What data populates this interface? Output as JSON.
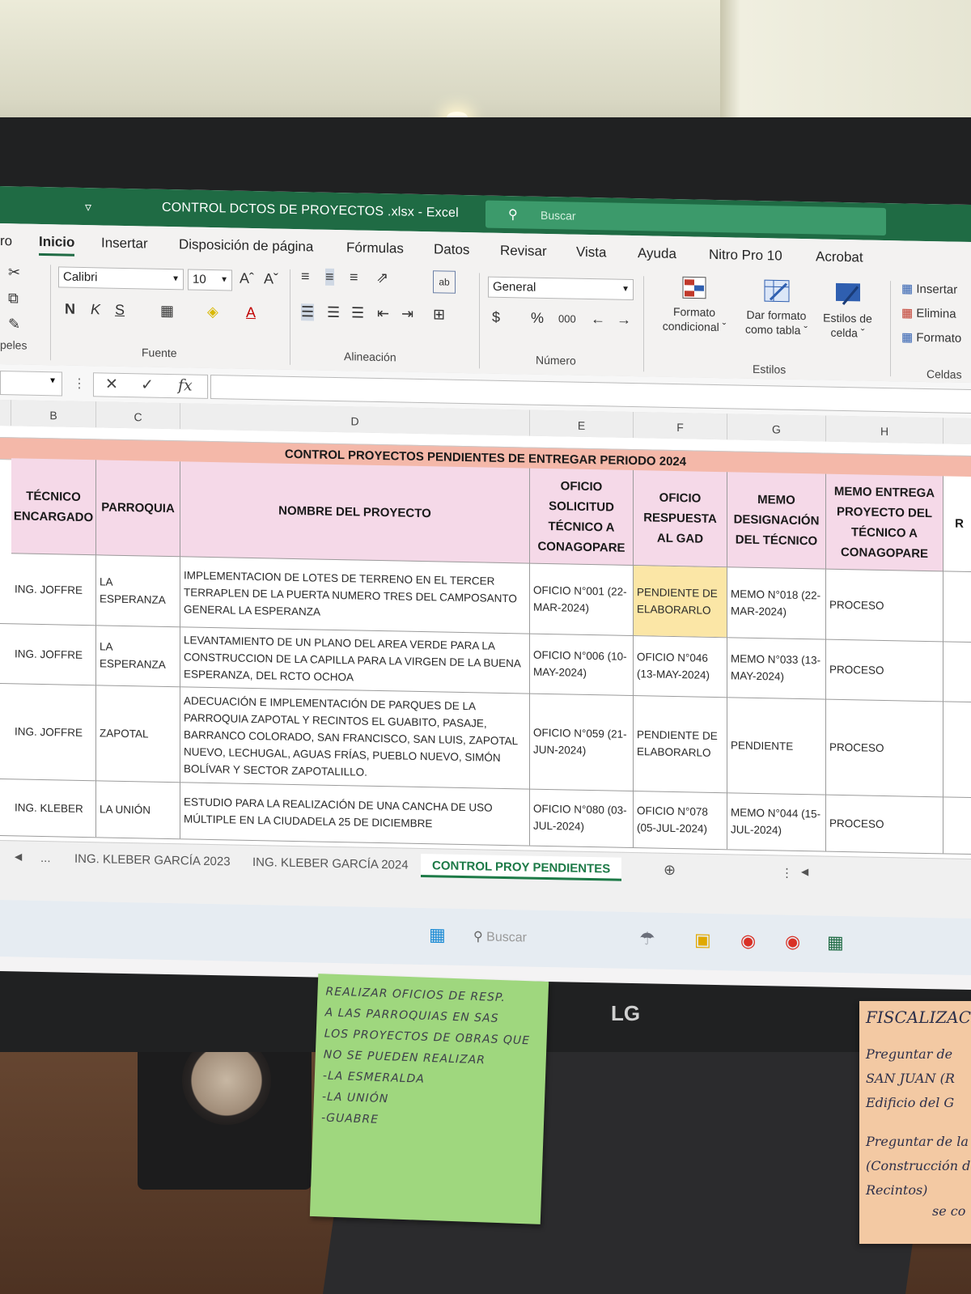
{
  "window": {
    "title": "CONTROL DCTOS DE PROYECTOS .xlsx  -  Excel",
    "search_placeholder": "Buscar",
    "qat_symbol": "▿"
  },
  "tabs": [
    "ro",
    "Inicio",
    "Insertar",
    "Disposición de página",
    "Fórmulas",
    "Datos",
    "Revisar",
    "Vista",
    "Ayuda",
    "Nitro Pro 10",
    "Acrobat"
  ],
  "ribbon": {
    "clipboard_label": "peles",
    "font_name": "Calibri",
    "font_size": "10",
    "grow_font": "Aˆ",
    "shrink_font": "Aˇ",
    "bold": "N",
    "italic": "K",
    "underline": "S",
    "font_group": "Fuente",
    "align_group": "Alineación",
    "number_format": "General",
    "currency": "$",
    "percent": "%",
    "thousands": "000",
    "number_group": "Número",
    "cond_format": [
      "Formato",
      "condicional ˇ"
    ],
    "table_format": [
      "Dar formato",
      "como tabla ˇ"
    ],
    "cell_styles": [
      "Estilos de",
      "celda ˇ"
    ],
    "styles_group": "Estilos",
    "insert": "Insertar",
    "delete": "Elimina",
    "format": "Formato",
    "cells_group": "Celdas"
  },
  "formula_bar": {
    "cancel": "✕",
    "enter": "✓",
    "fx": "fx"
  },
  "columns": [
    "B",
    "C",
    "D",
    "E",
    "F",
    "G",
    "H"
  ],
  "sheet": {
    "banner": "CONTROL PROYECTOS PENDIENTES DE ENTREGAR PERIODO 2024",
    "headers": [
      "TÉCNICO ENCARGADO",
      "PARROQUIA",
      "NOMBRE DEL PROYECTO",
      "OFICIO SOLICITUD TÉCNICO A CONAGOPARE",
      "OFICIO RESPUESTA AL GAD",
      "MEMO DESIGNACIÓN DEL TÉCNICO",
      "MEMO ENTREGA PROYECTO DEL TÉCNICO A CONAGOPARE",
      "R"
    ],
    "rows": [
      {
        "tecnico": "ING. JOFFRE",
        "parroquia": "LA ESPERANZA",
        "proyecto": "IMPLEMENTACION DE LOTES DE TERRENO EN EL TERCER TERRAPLEN DE LA PUERTA NUMERO TRES DEL CAMPOSANTO GENERAL LA ESPERANZA",
        "oficio_solicitud": "OFICIO N°001 (22-MAR-2024)",
        "oficio_respuesta": "PENDIENTE DE ELABORARLO",
        "memo_designacion": "MEMO N°018 (22-MAR-2024)",
        "memo_entrega": "PROCESO"
      },
      {
        "tecnico": "ING. JOFFRE",
        "parroquia": "LA ESPERANZA",
        "proyecto": "LEVANTAMIENTO DE UN PLANO DEL AREA VERDE PARA LA CONSTRUCCION DE LA CAPILLA PARA LA VIRGEN DE LA BUENA ESPERANZA, DEL RCTO OCHOA",
        "oficio_solicitud": "OFICIO N°006 (10-MAY-2024)",
        "oficio_respuesta": "OFICIO N°046 (13-MAY-2024)",
        "memo_designacion": "MEMO N°033 (13-MAY-2024)",
        "memo_entrega": "PROCESO"
      },
      {
        "tecnico": "ING. JOFFRE",
        "parroquia": "ZAPOTAL",
        "proyecto": "ADECUACIÓN E IMPLEMENTACIÓN DE PARQUES DE LA PARROQUIA ZAPOTAL Y RECINTOS EL GUABITO, PASAJE, BARRANCO COLORADO, SAN FRANCISCO, SAN LUIS, ZAPOTAL NUEVO, LECHUGAL, AGUAS FRÍAS, PUEBLO NUEVO, SIMÓN BOLÍVAR Y SECTOR ZAPOTALILLO.",
        "oficio_solicitud": "OFICIO N°059 (21-JUN-2024)",
        "oficio_respuesta": "PENDIENTE DE ELABORARLO",
        "memo_designacion": "PENDIENTE",
        "memo_entrega": "PROCESO"
      },
      {
        "tecnico": "ING. KLEBER",
        "parroquia": "LA UNIÓN",
        "proyecto": "ESTUDIO PARA LA REALIZACIÓN DE UNA CANCHA DE USO MÚLTIPLE EN LA CIUDADELA 25 DE DICIEMBRE",
        "oficio_solicitud": "OFICIO N°080 (03-JUL-2024)",
        "oficio_respuesta": "OFICIO N°078 (05-JUL-2024)",
        "memo_designacion": "MEMO N°044 (15-JUL-2024)",
        "memo_entrega": "PROCESO"
      }
    ]
  },
  "sheet_tabs": [
    "...",
    "ING. KLEBER GARCÍA 2023",
    "ING. KLEBER GARCÍA 2024",
    "CONTROL PROY PENDIENTES"
  ],
  "add_sheet": "⊕",
  "taskbar": {
    "search": "Buscar"
  },
  "monitor_brand": "LG",
  "note_green": [
    "REALIZAR OFICIOS DE RESP.",
    "A LAS PARROQUIAS EN SAS",
    "LOS PROYECTOS DE OBRAS QUE",
    "NO SE PUEDEN REALIZAR",
    "-LA ESMERALDA",
    "-LA UNIÓN",
    "-GUABRE"
  ],
  "note_orange": [
    "FISCALIZAC",
    "Preguntar de",
    "SAN JUAN (R",
    "Edificio del G",
    "Preguntar de la",
    "(Construcción de",
    "Recintos)",
    "se co"
  ],
  "colors": {
    "excel_green": "#1f6b44",
    "header_pink": "#f5d9e8",
    "banner_salmon": "#f4b8a9",
    "highlight_yellow": "#fbe6a6",
    "sticky_green": "#9fd77e",
    "sticky_orange": "#f3c9a3"
  }
}
